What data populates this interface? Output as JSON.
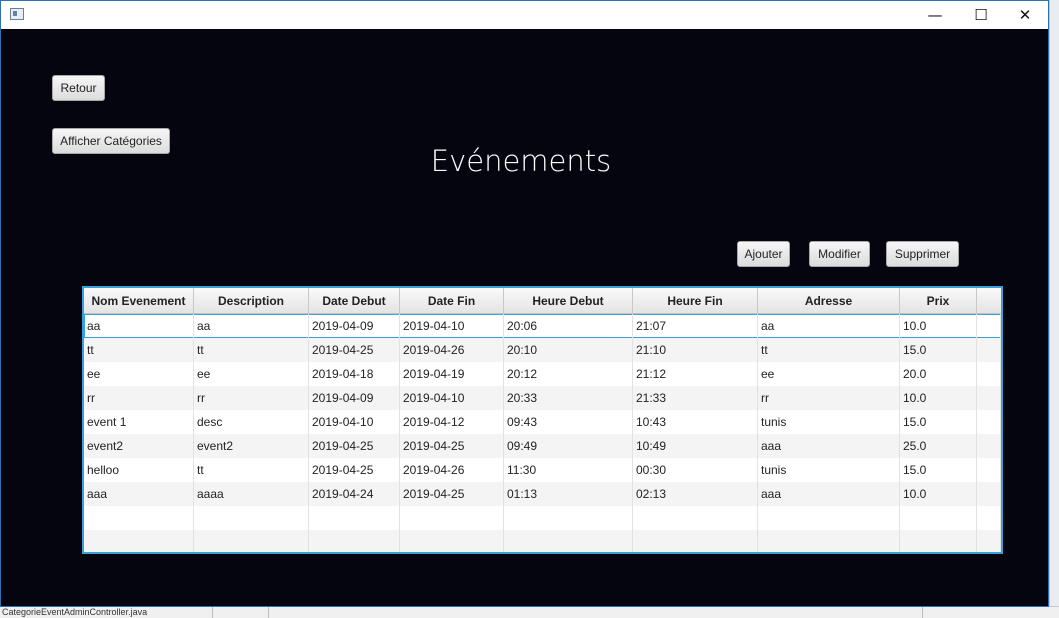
{
  "window": {
    "minimize": "—",
    "maximize": "☐",
    "close": "✕"
  },
  "nav": {
    "back_label": "Retour",
    "categories_label": "Afficher Catégories"
  },
  "page_title": "Evénements",
  "actions": {
    "add_label": "Ajouter",
    "edit_label": "Modifier",
    "delete_label": "Supprimer"
  },
  "table": {
    "columns": [
      "Nom Evenement",
      "Description",
      "Date Debut",
      "Date Fin",
      "Heure Debut",
      "Heure Fin",
      "Adresse",
      "Prix"
    ],
    "rows": [
      [
        "aa",
        "aa",
        "2019-04-09",
        "2019-04-10",
        "20:06",
        "21:07",
        "aa",
        "10.0"
      ],
      [
        "tt",
        "tt",
        "2019-04-25",
        "2019-04-26",
        "20:10",
        "21:10",
        "tt",
        "15.0"
      ],
      [
        "ee",
        "ee",
        "2019-04-18",
        "2019-04-19",
        "20:12",
        "21:12",
        "ee",
        "20.0"
      ],
      [
        "rr",
        "rr",
        "2019-04-09",
        "2019-04-10",
        "20:33",
        "21:33",
        "rr",
        "10.0"
      ],
      [
        "event 1",
        "desc",
        "2019-04-10",
        "2019-04-12",
        "09:43",
        "10:43",
        "tunis",
        "15.0"
      ],
      [
        "event2",
        "event2",
        "2019-04-25",
        "2019-04-25",
        "09:49",
        "10:49",
        "aaa",
        "25.0"
      ],
      [
        "helloo",
        "tt",
        "2019-04-25",
        "2019-04-26",
        "11:30",
        "00:30",
        "tunis",
        "15.0"
      ],
      [
        "aaa",
        "aaaa",
        "2019-04-24",
        "2019-04-25",
        "01:13",
        "02:13",
        "aaa",
        "10.0"
      ]
    ],
    "selected_row": 0
  },
  "background_ide": {
    "filename": "CategorieEventAdminController.java"
  },
  "colors": {
    "window_bg": "#05050f",
    "table_border": "#3aa0d8"
  }
}
